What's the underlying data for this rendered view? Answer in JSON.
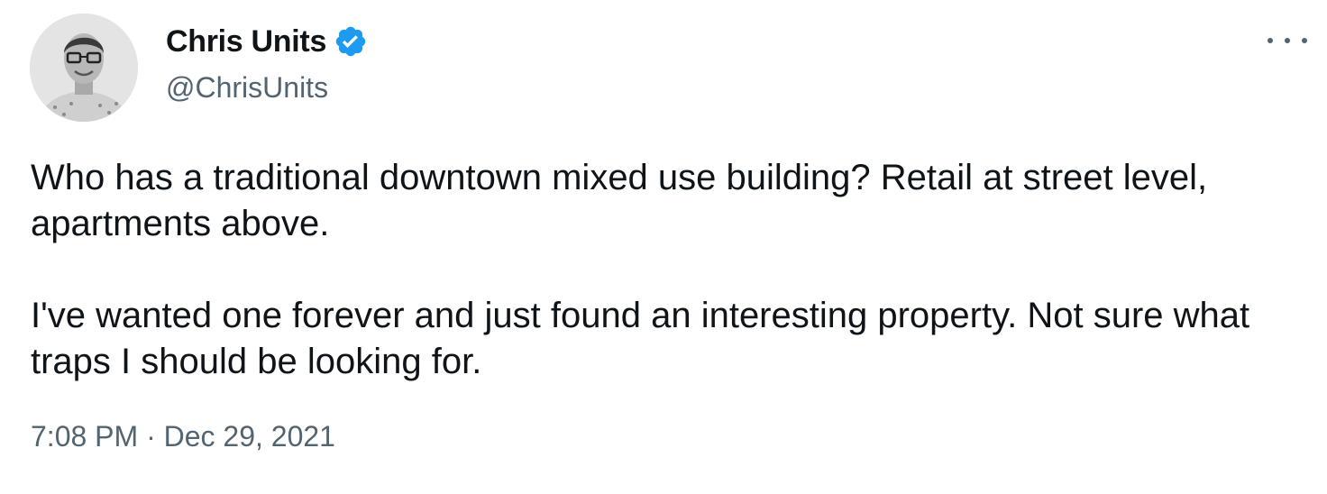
{
  "tweet": {
    "author": {
      "display_name": "Chris Units",
      "handle": "@ChrisUnits",
      "verified": true,
      "avatar_icon": "profile-photo"
    },
    "more_icon": "ellipsis-icon",
    "paragraphs": [
      "Who has a traditional downtown mixed use building? Retail at street level, apartments above.",
      "I've wanted one forever and just found an interesting property. Not sure what traps I should be looking for."
    ],
    "time": "7:08 PM",
    "separator": "·",
    "date": "Dec 29, 2021"
  },
  "colors": {
    "text_primary": "#0f1419",
    "text_secondary": "#536471",
    "verified_blue": "#1d9bf0"
  }
}
